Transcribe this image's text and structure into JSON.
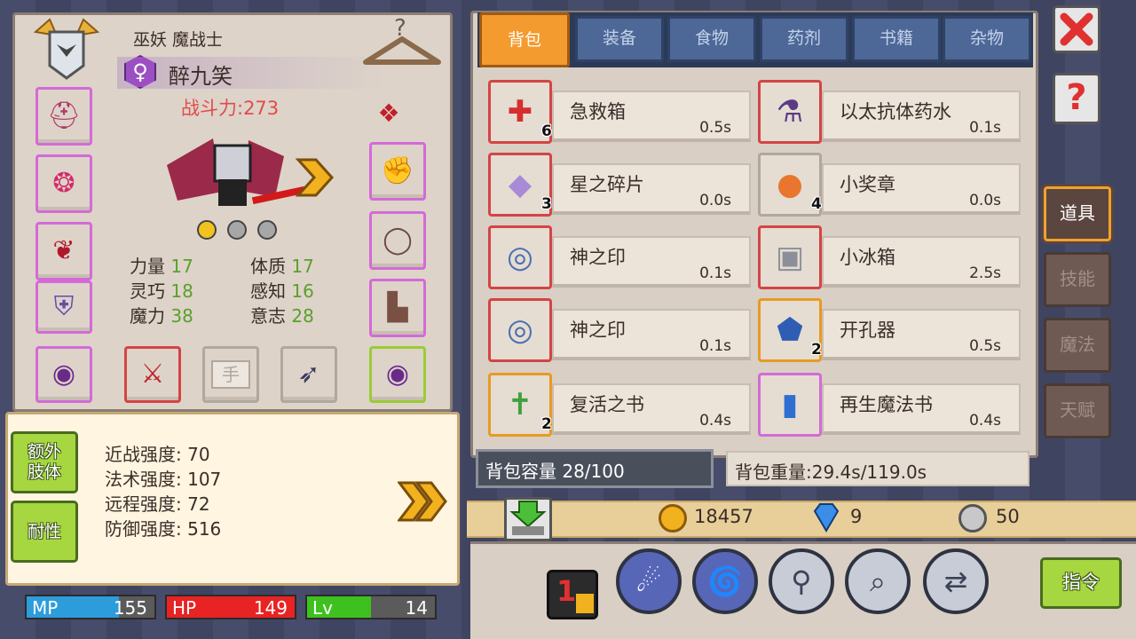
{
  "character": {
    "class_title": "巫妖 魔战士",
    "name": "醉九笑",
    "gender_symbol": "♀",
    "power": "战斗力:273",
    "attributes": [
      {
        "label": "力量",
        "value": "17"
      },
      {
        "label": "体质",
        "value": "17"
      },
      {
        "label": "灵巧",
        "value": "18"
      },
      {
        "label": "感知",
        "value": "16"
      },
      {
        "label": "魔力",
        "value": "38"
      },
      {
        "label": "意志",
        "value": "28"
      }
    ],
    "hand_slot_label": "手",
    "page_dots": {
      "count": 3,
      "active": 0
    }
  },
  "strengths": {
    "buttons": [
      "额外\n肢体",
      "耐性"
    ],
    "lines": [
      "近战强度: 70",
      "法术强度: 107",
      "远程强度: 72",
      "防御强度: 516"
    ]
  },
  "status_bars": [
    {
      "label": "MP",
      "value": "155",
      "fill": 0.72,
      "color": "#2d9cdb"
    },
    {
      "label": "HP",
      "value": "149",
      "fill": 1.0,
      "color": "#e82323"
    },
    {
      "label": "Lv",
      "value": "14",
      "fill": 0.5,
      "color": "#3ec11f"
    }
  ],
  "tabs": [
    "背包",
    "装备",
    "食物",
    "药剂",
    "书籍",
    "杂物"
  ],
  "active_tab": 0,
  "items": [
    {
      "name": "急救箱",
      "weight": "0.5s",
      "count": "6",
      "icon": "first-aid-kit-icon",
      "glyph": "✚",
      "glyph_color": "#d62e2e",
      "border": "red"
    },
    {
      "name": "以太抗体药水",
      "weight": "0.1s",
      "count": "",
      "icon": "potion-flask-icon",
      "glyph": "⚗",
      "glyph_color": "#5b3a86",
      "border": "red"
    },
    {
      "name": "星之碎片",
      "weight": "0.0s",
      "count": "3",
      "icon": "crystal-shard-icon",
      "glyph": "◆",
      "glyph_color": "#a98ad6",
      "border": "red"
    },
    {
      "name": "小奖章",
      "weight": "0.0s",
      "count": "4",
      "icon": "medal-icon",
      "glyph": "●",
      "glyph_color": "#e8762e",
      "border": "gray"
    },
    {
      "name": "神之印",
      "weight": "0.1s",
      "count": "",
      "icon": "divine-seal-icon",
      "glyph": "◎",
      "glyph_color": "#4a6fb0",
      "border": "red"
    },
    {
      "name": "小冰箱",
      "weight": "2.5s",
      "count": "",
      "icon": "small-fridge-icon",
      "glyph": "▣",
      "glyph_color": "#8a8f99",
      "border": "red"
    },
    {
      "name": "神之印",
      "weight": "0.1s",
      "count": "",
      "icon": "divine-seal-icon",
      "glyph": "◎",
      "glyph_color": "#4a6fb0",
      "border": "red"
    },
    {
      "name": "开孔器",
      "weight": "0.5s",
      "count": "2",
      "icon": "hole-drill-icon",
      "glyph": "⬟",
      "glyph_color": "#2e5db3",
      "border": "orange"
    },
    {
      "name": "复活之书",
      "weight": "0.4s",
      "count": "2",
      "icon": "resurrection-book-icon",
      "glyph": "✝",
      "glyph_color": "#3fa13f",
      "border": "orange"
    },
    {
      "name": "再生魔法书",
      "weight": "0.4s",
      "count": "",
      "icon": "regen-magic-book-icon",
      "glyph": "▮",
      "glyph_color": "#2e6fd1",
      "border": "pink"
    }
  ],
  "bag": {
    "capacity": "背包容量 28/100",
    "weight": "背包重量:29.4s/119.0s"
  },
  "currency": {
    "gold": "18457",
    "gems": "9",
    "silver": "50"
  },
  "side_tabs": [
    "道具",
    "技能",
    "魔法",
    "天赋"
  ],
  "active_side_tab": 0,
  "command_button": "指令"
}
